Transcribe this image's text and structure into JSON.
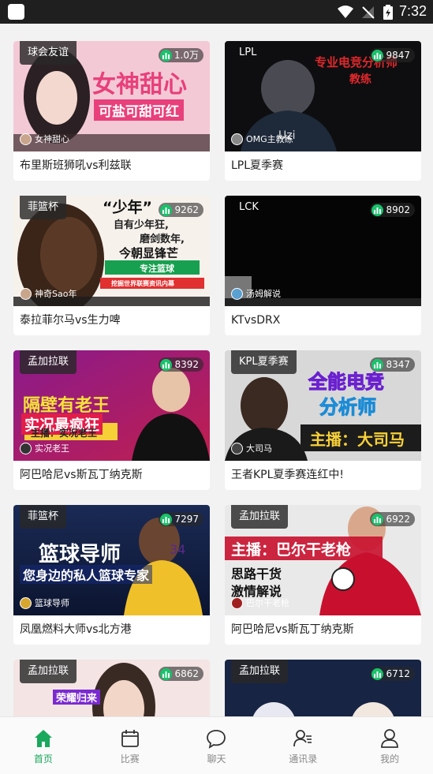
{
  "status_bar": {
    "time": "7:32"
  },
  "cards": [
    {
      "tag": "球会友谊",
      "heat": "1.0万",
      "anchor": "女神甜心",
      "title": "布里斯班狮吼vs利兹联",
      "overlay": [
        "女神甜心",
        "可盐可甜可红"
      ]
    },
    {
      "tag": "LPL",
      "heat": "9847",
      "anchor": "OMG主教练",
      "title": "LPL夏季赛",
      "overlay": [
        "专业电竞分析师",
        "教练"
      ]
    },
    {
      "tag": "菲篮杯",
      "heat": "9262",
      "anchor": "神奇Sao年",
      "title": "泰拉菲尔马vs生力啤",
      "overlay": [
        "“少年”",
        "自有少年狂,",
        "磨剑数年,",
        "今朝显锋芒",
        "专注篮球",
        "挖掘世界联赛资讯内幕"
      ]
    },
    {
      "tag": "LCK",
      "heat": "8902",
      "anchor": "汤姆解说",
      "title": "KTvsDRX",
      "overlay": []
    },
    {
      "tag": "孟加拉联",
      "heat": "8392",
      "anchor": "实况老王",
      "title": "阿巴哈尼vs斯瓦丁纳克斯",
      "overlay": [
        "隔壁有老王",
        "实况最疯狂",
        "主播：实况老王"
      ]
    },
    {
      "tag": "KPL夏季赛",
      "heat": "8347",
      "anchor": "大司马",
      "title": "王者KPL夏季赛连红中!",
      "overlay": [
        "全能电竞",
        "分析师",
        "主播：大司马"
      ]
    },
    {
      "tag": "菲篮杯",
      "heat": "7297",
      "anchor": "篮球导师",
      "title": "凤凰燃料大师vs北方港",
      "overlay": [
        "篮球导师",
        "您身边的私人篮球专家"
      ]
    },
    {
      "tag": "孟加拉联",
      "heat": "6922",
      "anchor": "巴尔干老枪",
      "title": "阿巴哈尼vs斯瓦丁纳克斯",
      "overlay": [
        "主播：巴尔干老枪",
        "思路干货",
        "激情解说"
      ]
    },
    {
      "tag": "孟加拉联",
      "heat": "6862",
      "anchor": "",
      "title": "",
      "overlay": [
        "荣耀归来"
      ]
    },
    {
      "tag": "孟加拉联",
      "heat": "6712",
      "anchor": "",
      "title": "",
      "overlay": []
    }
  ],
  "tabs": [
    {
      "label": "首页",
      "icon": "home-icon"
    },
    {
      "label": "比赛",
      "icon": "calendar-icon"
    },
    {
      "label": "聊天",
      "icon": "chat-bubble-icon"
    },
    {
      "label": "通讯录",
      "icon": "contacts-icon"
    },
    {
      "label": "我的",
      "icon": "user-icon"
    }
  ],
  "colors": {
    "accent": "#19a85c",
    "heat_icon": "#19c26b"
  }
}
